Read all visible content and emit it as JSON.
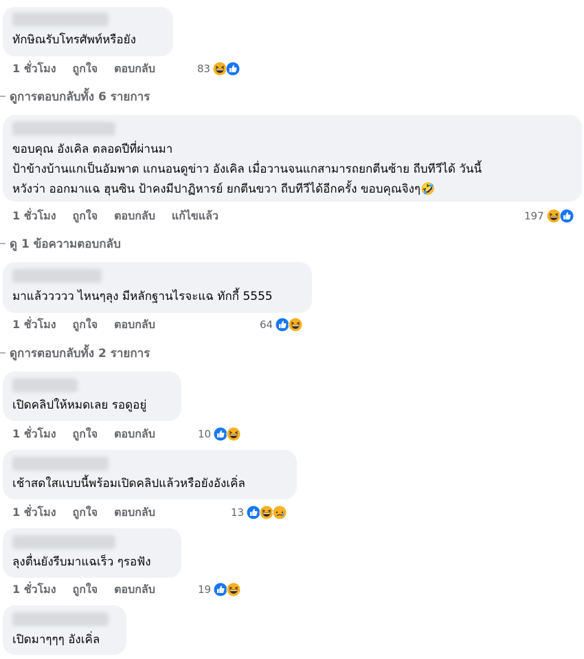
{
  "comments": [
    {
      "lines": [
        "ทักษิณรับโทรศัพท์หรือยัง"
      ],
      "time": "1 ชั่วโมง",
      "like": "ถูกใจ",
      "reply": "ตอบกลับ",
      "edited": "",
      "count": "83",
      "reactions": [
        "haha-icon",
        "like-icon"
      ]
    },
    {
      "lines": [
        "ขอบคุณ อังเคิล ตลอดปีที่ผ่านมา",
        "ป้าข้างบ้านแกเป็นอัมพาต แกนอนดูข่าว อังเคิล เมื่อวานจนแกสามารถยกตีนซ้าย ถีบทีวีได้ วันนี้",
        "หวังว่า ออกมาแฉ ฮุนซิน ป้าคงมีปาฏิหารย์ ยกตีนขวา ถีบทีวีได้อีกครั้ง ขอบคุณจิงๆ🤣"
      ],
      "time": "1 ชั่วโมง",
      "like": "ถูกใจ",
      "reply": "ตอบกลับ",
      "edited": "แก้ไขแล้ว",
      "count": "197",
      "reactions": [
        "haha-icon",
        "like-icon"
      ]
    },
    {
      "lines": [
        "มาแล้ววววว ไหนๆลุง มีหลักฐานไรจะแฉ ทักกี้ 5555"
      ],
      "time": "1 ชั่วโมง",
      "like": "ถูกใจ",
      "reply": "ตอบกลับ",
      "edited": "",
      "count": "64",
      "reactions": [
        "like-icon",
        "haha-icon"
      ]
    },
    {
      "lines": [
        "เปิดคลิปให้หมดเลย รอดูอยู่"
      ],
      "time": "1 ชั่วโมง",
      "like": "ถูกใจ",
      "reply": "ตอบกลับ",
      "edited": "",
      "count": "10",
      "reactions": [
        "like-icon",
        "haha-icon"
      ]
    },
    {
      "lines": [
        "เช้าสดใสแบบนี้พร้อมเปิดคลิปแล้วหรือยังอังเคิ่ล"
      ],
      "time": "1 ชั่วโมง",
      "like": "ถูกใจ",
      "reply": "ตอบกลับ",
      "edited": "",
      "count": "13",
      "reactions": [
        "like-icon",
        "haha-icon",
        "sad-icon"
      ]
    },
    {
      "lines": [
        "ลุงตื่นยังรีบมาแฉเร็ว ๆรอฟัง"
      ],
      "time": "1 ชั่วโมง",
      "like": "ถูกใจ",
      "reply": "ตอบกลับ",
      "edited": "",
      "count": "19",
      "reactions": [
        "like-icon",
        "haha-icon"
      ]
    },
    {
      "lines": [
        "เปิดมาๆๆๆ อังเคิ่ล"
      ],
      "time": "",
      "like": "",
      "reply": "",
      "edited": "",
      "count": "",
      "reactions": []
    }
  ],
  "view_replies": [
    "ดูการตอบกลับทั้ง 6 รายการ",
    "ดู 1 ข้อความตอบกลับ",
    "ดูการตอบกลับทั้ง 2 รายการ"
  ],
  "colors": {
    "bubble": "#f0f2f5",
    "like": "#1877f2",
    "haha": "#f7b125",
    "meta_text": "#65676b"
  }
}
